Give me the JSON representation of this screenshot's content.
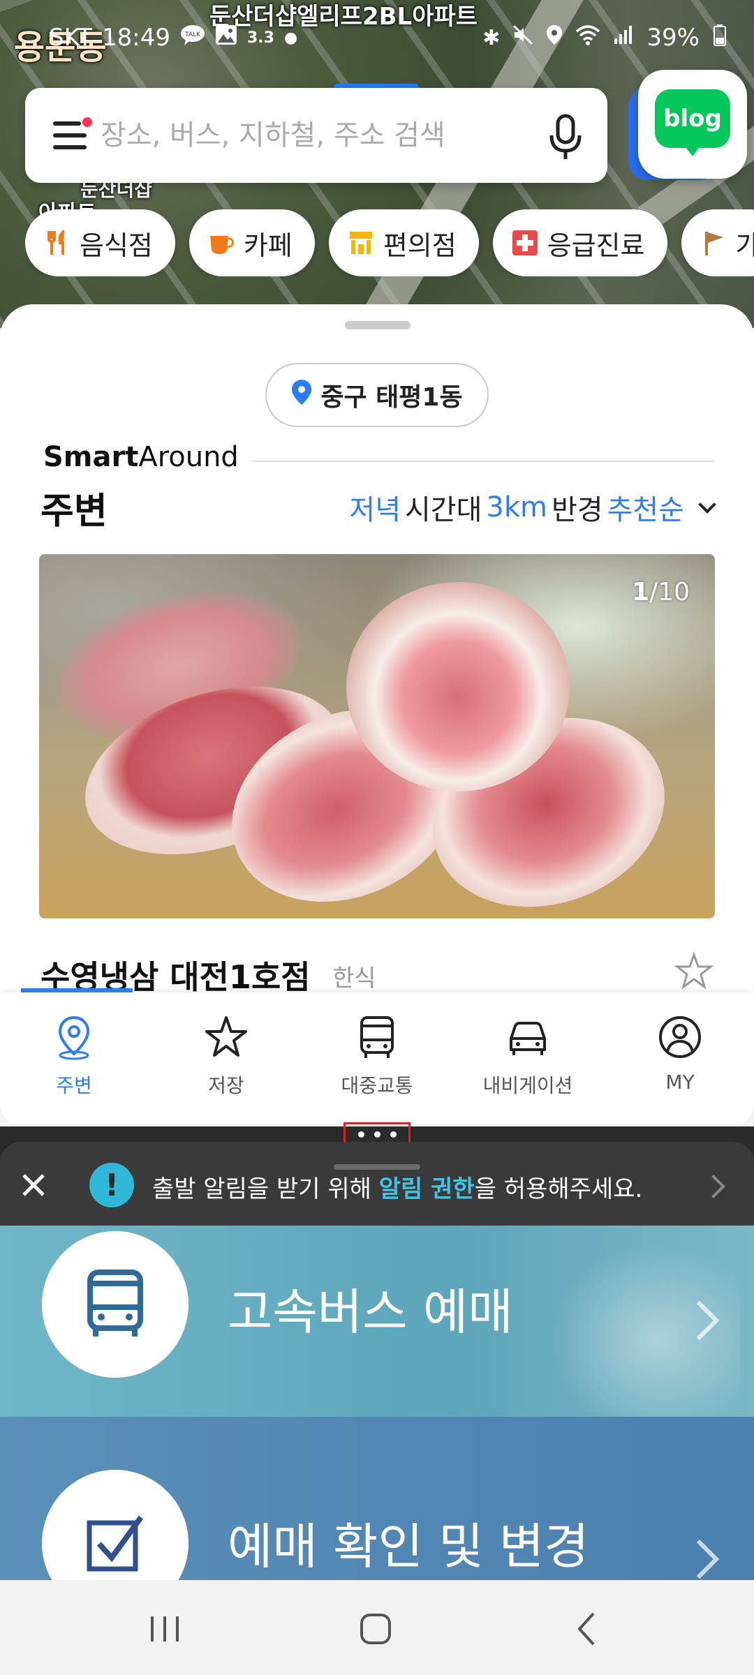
{
  "map": {
    "label_top": "둔산더샵엘리프2BL아파트",
    "label_area": "용문동",
    "label_small": "둔산더샵",
    "label_apt": "아파트"
  },
  "status_bar": {
    "carrier": "SKT",
    "time": "18:49",
    "talk_badge": "TALK",
    "weather": "3.3",
    "battery": "39%"
  },
  "search": {
    "placeholder": "장소, 버스, 지하철, 주소 검색",
    "value": ""
  },
  "blog_button": {
    "label": "blog"
  },
  "categories": [
    {
      "label": "음식점",
      "icon": "utensils-icon",
      "color": "#f07a1a"
    },
    {
      "label": "카페",
      "icon": "coffee-cup-icon",
      "color": "#f07a1a"
    },
    {
      "label": "편의점",
      "icon": "store-icon",
      "color": "#f5b500"
    },
    {
      "label": "응급진료",
      "icon": "medical-cross-icon",
      "color": "#e84a4a"
    },
    {
      "label": "가",
      "icon": "flag-icon",
      "color": "#b07a40"
    }
  ],
  "sheet": {
    "location": "중구 태평1동",
    "brand_bold": "Smart",
    "brand_regular": "Around",
    "title": "주변",
    "filters": {
      "time": "저녁",
      "time_suffix": "시간대",
      "radius": "3km",
      "radius_suffix": "반경",
      "sort": "추천순"
    },
    "photo_counter": {
      "current": "1",
      "total": "/10"
    },
    "place": {
      "name": "수영냉삼 대전1호점",
      "category": "한식"
    }
  },
  "bottom_nav": {
    "items": [
      {
        "label": "주변",
        "icon": "location-pin-icon",
        "active": true
      },
      {
        "label": "저장",
        "icon": "star-icon",
        "active": false
      },
      {
        "label": "대중교통",
        "icon": "bus-icon",
        "active": false
      },
      {
        "label": "내비게이션",
        "icon": "car-icon",
        "active": false
      },
      {
        "label": "MY",
        "icon": "person-icon",
        "active": false
      }
    ]
  },
  "notification": {
    "text_before": "출발 알림을 받기 위해 ",
    "text_highlight": "알림 권한",
    "text_after": "을 허용해주세요."
  },
  "banners": [
    {
      "title": "고속버스 예매",
      "icon": "bus-icon"
    },
    {
      "title": "예매 확인 및 변경",
      "icon": "checkbox-icon"
    }
  ],
  "colors": {
    "accent": "#2d7cf6",
    "blog_green": "#03c75a",
    "notify_highlight": "#42c4e6"
  }
}
